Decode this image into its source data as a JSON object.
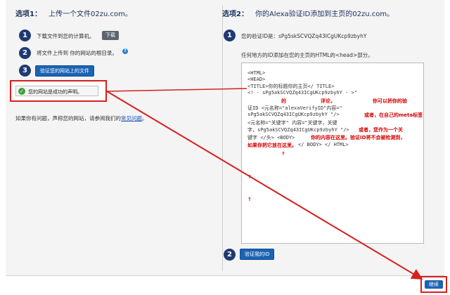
{
  "left": {
    "option_label": "选项1：",
    "option_title": "上传一个文件02zu.com。",
    "steps": [
      {
        "number": "1",
        "text": "下载文件到您的计算机。",
        "button": "下载"
      },
      {
        "number": "2",
        "text": "将文件上传到 你的网站的根目录。"
      },
      {
        "number": "3",
        "button": "验证您的网站上的文件"
      }
    ],
    "success_text": "您的网站是成功的声明。",
    "problem_text": "如果你有问题，声称您的网站，请参阅我们的",
    "faq_link": "常见问题",
    "faq_suffix": "。"
  },
  "right": {
    "option_label": "选项2：",
    "option_title": "你的Alexa验证ID添加到主页的02zu.com。",
    "step1_number": "1",
    "verify_id_line": "您的验证ID是：sPg5skSCVQZq43ICgUKcp9zbyhY",
    "instruction": "任何地方的ID添加在您的主页的HTML的<head>部分。",
    "code_lines": [
      "<HTML>",
      "<HEAD>",
      "<TITLE>你的标题你的主页</ TITLE>",
      "<!  - sPg5akSCVQZq43ICgUKcp9zbyhY - >\"",
      "",
      "证ID <元名称=\"alexaVerifyID\"内容=\"",
      "sPg5akSCVQZq43ICgUKcp9zbyhY \"/>",
      "<元名称=\"关键字\" 内容=\"关键字，关键",
      "字，sPg5akSCVQZq43ICgUKcp9zbyhY \"/>",
      "键字  </头> <BODY>",
      "                    </ BODY> </ HTML>"
    ],
    "red_annotations": {
      "de": "的",
      "comment": "评论，",
      "you_can": "你可以把你的验",
      "or_in": "或者，在自己的meta标签",
      "or_as": "或者，您作为一个关",
      "your_content": "你的内容在这里。验证ID将不会被检测到，",
      "if_you": "如果你把它放在这里。",
      "mark1": "↑",
      "mark2": "↑",
      "mark3": "↑"
    },
    "step2_number": "2",
    "verify_button": "验证我的ID"
  },
  "continue_button": "继续",
  "colors": {
    "accent_red": "#d62020",
    "step_navy": "#1f3a73",
    "button_blue": "#1b63b3",
    "success_green": "#3aa33a"
  }
}
